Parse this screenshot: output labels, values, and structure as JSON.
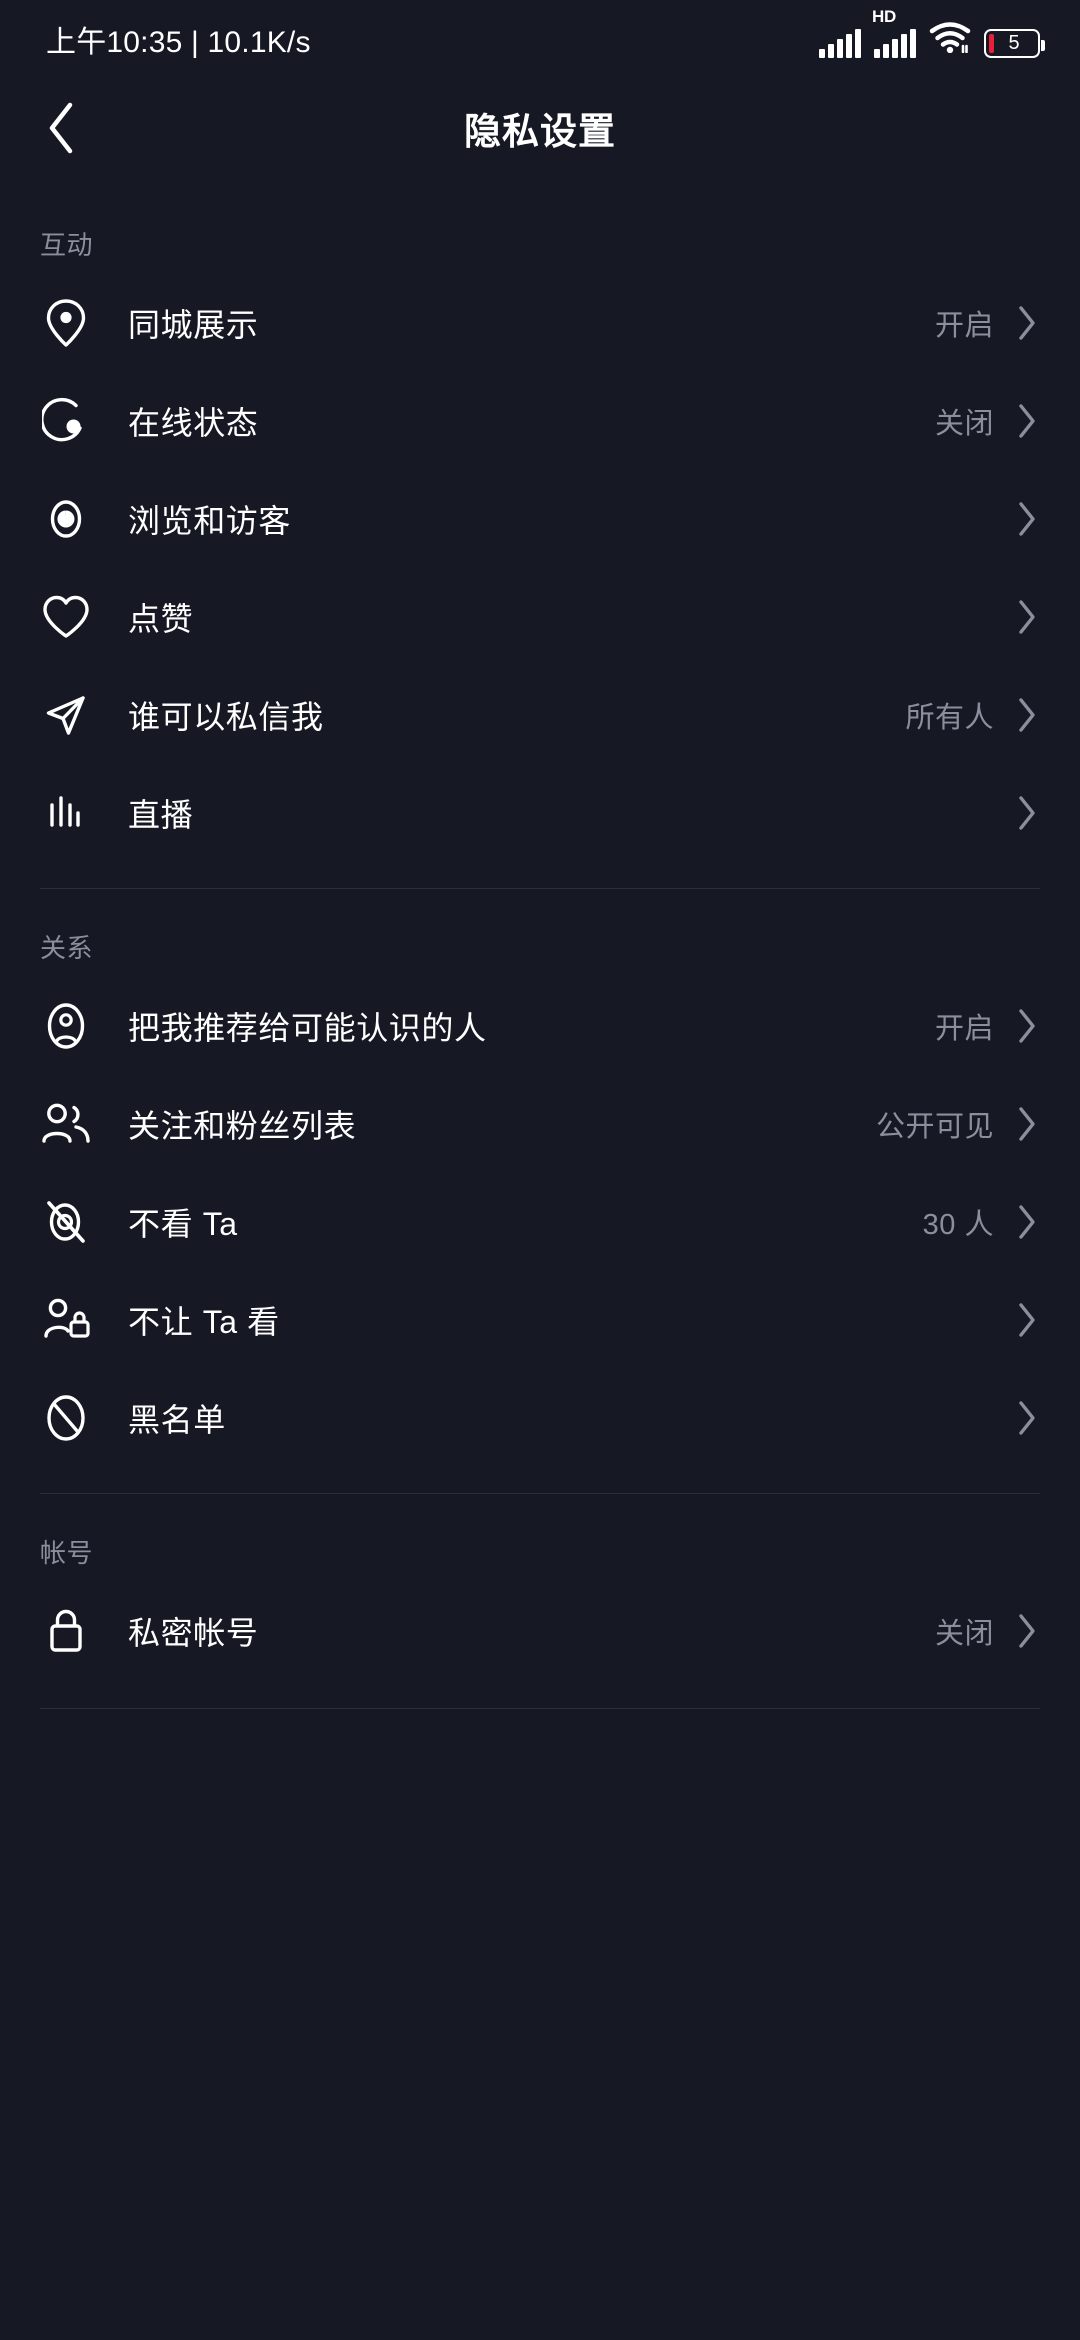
{
  "statusbar": {
    "time_text": "上午10:35 | 10.1K/s",
    "hd_label": "HD",
    "battery_percent": "5"
  },
  "navbar": {
    "title": "隐私设置",
    "back_icon": "chevron-left-icon"
  },
  "sections": [
    {
      "header": "互动",
      "rows": [
        {
          "icon": "location-pin-icon",
          "label": "同城展示",
          "value": "开启"
        },
        {
          "icon": "online-status-icon",
          "label": "在线状态",
          "value": "关闭"
        },
        {
          "icon": "eye-view-icon",
          "label": "浏览和访客",
          "value": ""
        },
        {
          "icon": "heart-icon",
          "label": "点赞",
          "value": ""
        },
        {
          "icon": "paper-plane-icon",
          "label": "谁可以私信我",
          "value": "所有人"
        },
        {
          "icon": "live-bars-icon",
          "label": "直播",
          "value": ""
        }
      ]
    },
    {
      "header": "关系",
      "rows": [
        {
          "icon": "person-circle-icon",
          "label": "把我推荐给可能认识的人",
          "value": "开启"
        },
        {
          "icon": "people-group-icon",
          "label": "关注和粉丝列表",
          "value": "公开可见"
        },
        {
          "icon": "eye-off-icon",
          "label": "不看 Ta",
          "value": "30 人"
        },
        {
          "icon": "person-lock-icon",
          "label": "不让 Ta 看",
          "value": ""
        },
        {
          "icon": "block-icon",
          "label": "黑名单",
          "value": ""
        }
      ]
    },
    {
      "header": "帐号",
      "rows": [
        {
          "icon": "lock-icon",
          "label": "私密帐号",
          "value": "关闭"
        }
      ]
    }
  ],
  "colors": {
    "background": "#161824",
    "text_primary": "#ffffff",
    "text_secondary": "#8b8e9c",
    "divider": "#2b2e3c",
    "battery_low": "#e8203a"
  }
}
